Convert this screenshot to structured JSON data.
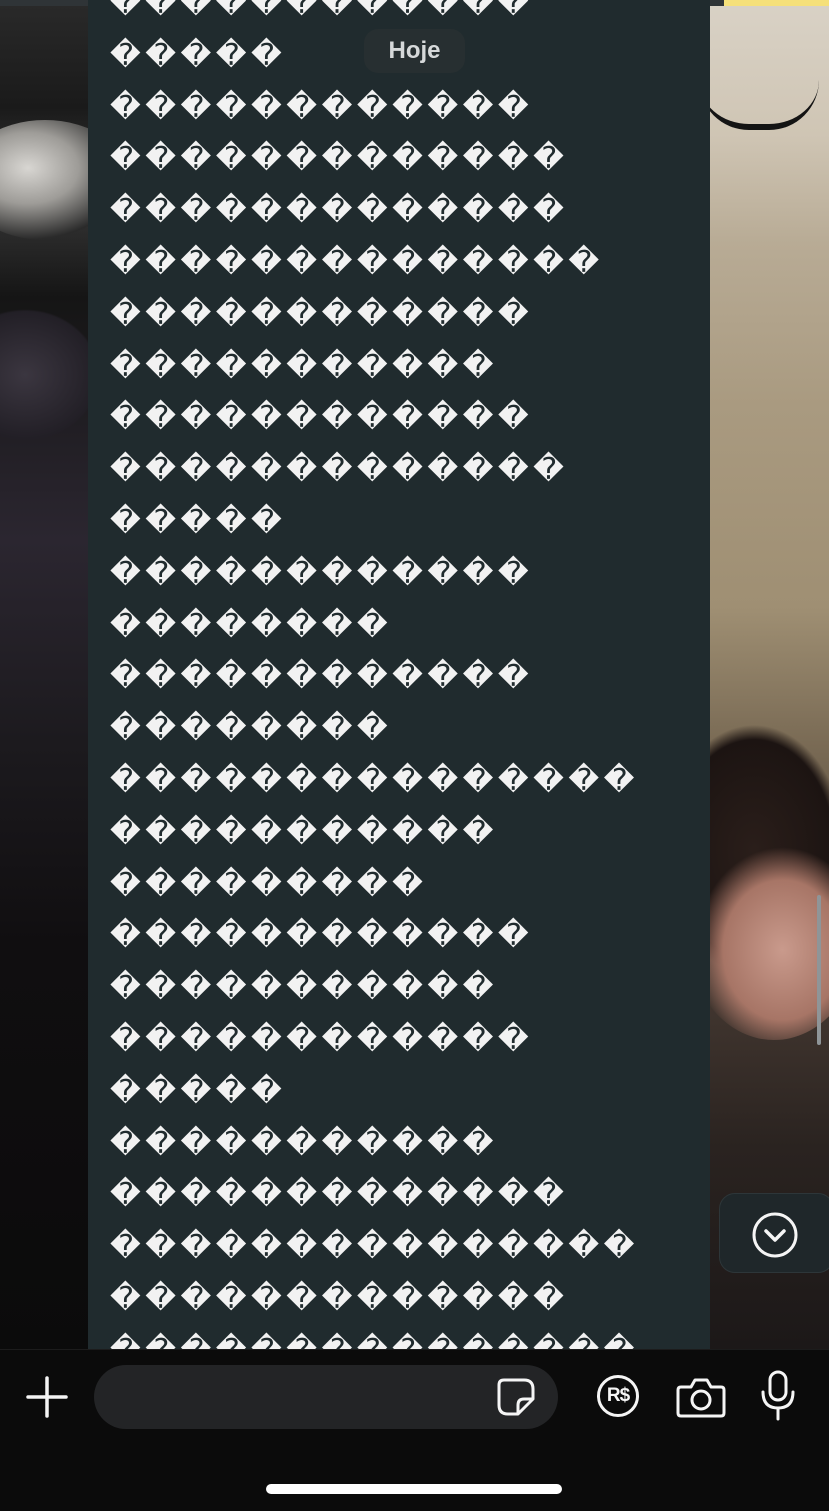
{
  "chat": {
    "date_divider": "Hoje",
    "message_lines": [
      "������������",
      "�����",
      "������������",
      "�������������",
      "�������������",
      "��������������",
      "������������",
      "�����������",
      "������������",
      "�������������",
      "�����",
      "������������",
      "��������",
      "������������",
      "��������",
      "���������������",
      "�����������",
      "���������",
      "������������",
      "�����������",
      "������������",
      "�����",
      "�����������",
      "�������������",
      "���������������",
      "�������������",
      "���������������"
    ]
  },
  "composer": {
    "message_input_value": "",
    "attach_icon": "plus-icon",
    "sticker_icon": "sticker-icon",
    "payment_icon": "payment-brl-icon",
    "payment_label": "R$",
    "camera_icon": "camera-icon",
    "mic_icon": "microphone-icon"
  },
  "scroll_down_icon": "chevron-down-circle-icon",
  "colors": {
    "bubble_bg": "#202b2e",
    "message_text": "#f2f2f2",
    "composer_bg": "#0b0b0b",
    "input_bg": "#232426",
    "icon": "#f5f5f5"
  }
}
